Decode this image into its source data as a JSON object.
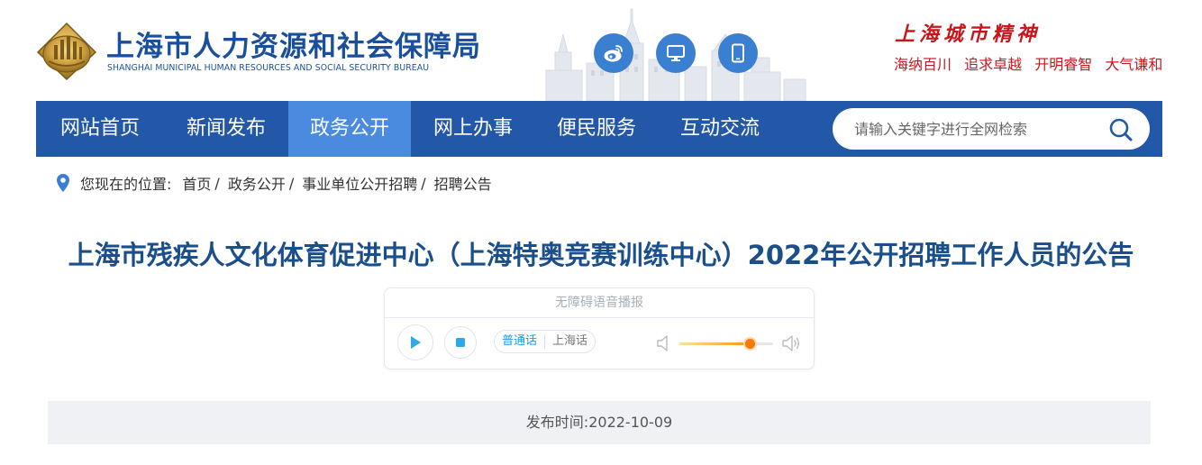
{
  "header": {
    "org_name_cn": "上海市人力资源和社会保障局",
    "org_name_en": "SHANGHAI MUNICIPAL HUMAN RESOURCES AND SOCIAL SECURITY BUREAU",
    "social_icons": [
      "weibo-icon",
      "desktop-icon",
      "mobile-icon"
    ],
    "spirit_title": "上海城市精神",
    "spirit_phrases": [
      "海纳百川",
      "追求卓越",
      "开明睿智",
      "大气谦和"
    ]
  },
  "nav": {
    "items": [
      {
        "label": "网站首页"
      },
      {
        "label": "新闻发布"
      },
      {
        "label": "政务公开",
        "active": true
      },
      {
        "label": "网上办事"
      },
      {
        "label": "便民服务"
      },
      {
        "label": "互动交流"
      }
    ],
    "search_placeholder": "请输入关键字进行全网检索"
  },
  "breadcrumb": {
    "label": "您现在的位置:",
    "items": [
      "首页",
      "政务公开",
      "事业单位公开招聘",
      "招聘公告"
    ]
  },
  "article": {
    "title": "上海市残疾人文化体育促进中心（上海特奥竞赛训练中心）2022年公开招聘工作人员的公告",
    "publish_label": "发布时间:",
    "publish_date": "2022-10-09"
  },
  "player": {
    "header": "无障碍语音播报",
    "lang_options": [
      "普通话",
      "上海话"
    ],
    "active_lang": "普通话",
    "volume_fraction": 0.75
  },
  "colors": {
    "brand_blue": "#2358a8",
    "nav_active": "#4a8be0",
    "title_blue": "#1a4f8c",
    "spirit_red": "#c8161d",
    "volume_orange": "#f47a10"
  }
}
